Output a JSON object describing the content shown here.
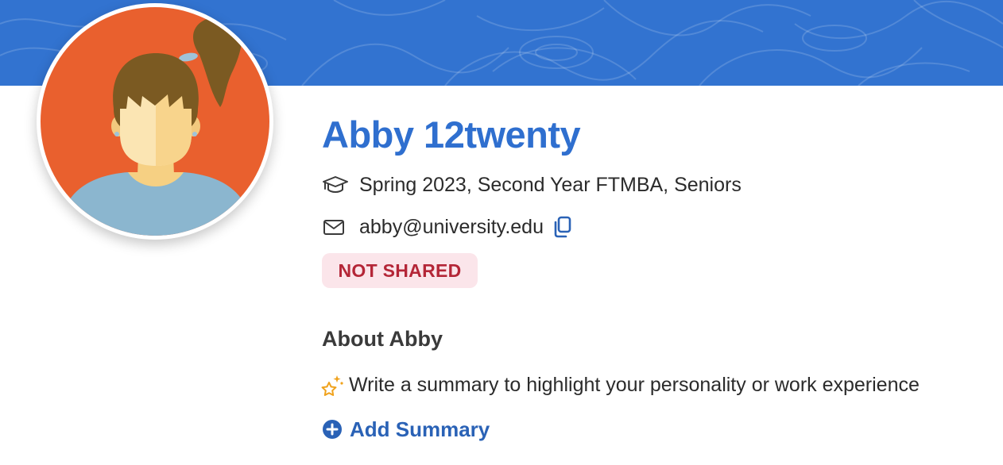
{
  "profile": {
    "name": "Abby 12twenty",
    "program": "Spring 2023, Second Year FTMBA, Seniors",
    "email": "abby@university.edu",
    "share_status": "NOT SHARED"
  },
  "about": {
    "title": "About Abby",
    "hint": "Write a summary to highlight your personality or work experience",
    "add_label": "Add Summary"
  },
  "icons": {
    "program": "graduation-cap-icon",
    "email": "envelope-icon",
    "copy": "copy-icon",
    "hint": "sparkle-star-icon",
    "add": "plus-circle-icon"
  },
  "colors": {
    "banner": "#3273d0",
    "name": "#2f6fcf",
    "badge_bg": "#fbe5ea",
    "badge_text": "#b42637",
    "link": "#2a62b6",
    "avatar_bg": "#e9602e"
  }
}
